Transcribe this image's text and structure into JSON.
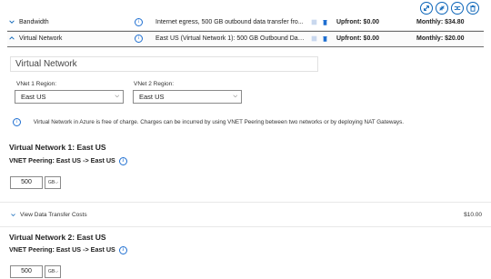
{
  "toolbar": {
    "icons": [
      "expand-icon",
      "collapse-icon",
      "shuffle-icon",
      "delete-icon"
    ]
  },
  "rows": [
    {
      "name": "Bandwidth",
      "description": "Internet egress, 500 GB outbound data transfer fro...",
      "upfront": "Upfront: $0.00",
      "monthly": "Monthly: $34.80",
      "expanded": false
    },
    {
      "name": "Virtual Network",
      "description": "East US (Virtual Network 1): 500 GB Outbound Data...",
      "upfront": "Upfront: $0.00",
      "monthly": "Monthly: $20.00",
      "expanded": true
    }
  ],
  "config": {
    "name_value": "Virtual Network",
    "vnet1_label": "VNet 1 Region:",
    "vnet1_value": "East US",
    "vnet2_label": "VNet 2 Region:",
    "vnet2_value": "East US",
    "notice": "Virtual Network in Azure is free of charge. Charges can be incurred by using VNET Peering between two networks or by deploying NAT Gateways.",
    "vn1": {
      "title": "Virtual Network 1: East US",
      "peering": "VNET Peering: East US -> East US",
      "qty": "500",
      "unit": "GB"
    },
    "transfer_label": "View Data Transfer Costs",
    "transfer_cost": "$10.00",
    "vn2": {
      "title": "Virtual Network 2: East US",
      "peering": "VNET Peering: East US -> East US",
      "qty": "500",
      "unit": "GB"
    }
  },
  "colors": {
    "accent": "#0a64b8",
    "delete": "#1f6fd1"
  }
}
